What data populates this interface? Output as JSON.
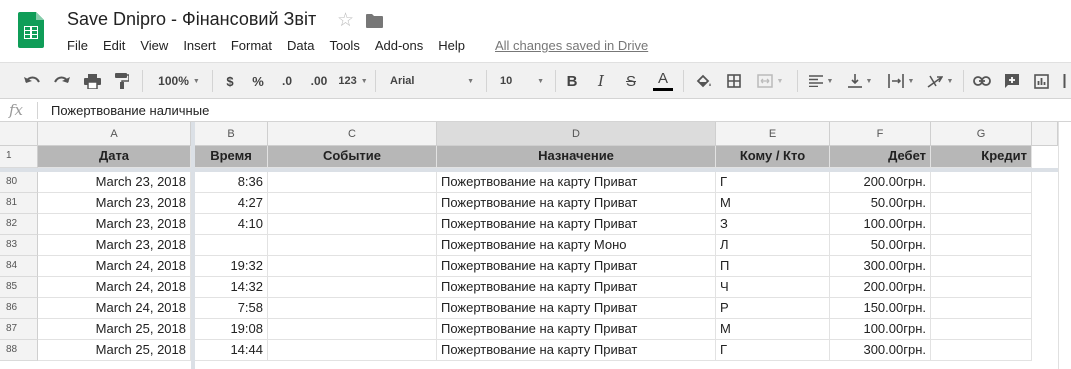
{
  "app": {
    "title": "Save Dnipro - Фінансовий Звіт",
    "star_icon": "☆",
    "saved_status": "All changes saved in Drive",
    "menu": [
      "File",
      "Edit",
      "View",
      "Insert",
      "Format",
      "Data",
      "Tools",
      "Add-ons",
      "Help"
    ],
    "brand_color": "#0f9d58"
  },
  "toolbar": {
    "zoom": "100%",
    "currency": "$",
    "percent": "%",
    "decrease_decimals": ".0",
    "increase_decimals": ".00",
    "more_formats": "123",
    "font": "Arial",
    "font_size": "10",
    "bold": "B",
    "italic": "I",
    "strikethrough": "S",
    "text_color": "A",
    "icons": [
      "undo-icon",
      "redo-icon",
      "print-icon",
      "paint-format-icon",
      "fill-color-icon",
      "borders-icon",
      "merge-cells-icon",
      "horizontal-align-icon",
      "vertical-align-icon",
      "text-wrap-icon",
      "text-rotation-icon",
      "link-icon",
      "comment-icon",
      "chart-icon"
    ]
  },
  "formula_bar": {
    "fx": "fx",
    "content": "Пожертвование наличные"
  },
  "grid": {
    "columns": [
      "A",
      "B",
      "C",
      "D",
      "E",
      "F",
      "G"
    ],
    "header_row_number": "1",
    "headers": [
      "Дата",
      "Время",
      "Событие",
      "Назначение",
      "Кому / Кто",
      "Дебет",
      "Кредит"
    ],
    "rows": [
      {
        "num": "80",
        "date": "March 23, 2018",
        "time": "8:36",
        "event": "",
        "purpose": "Пожертвование на карту Приват",
        "who": "Г",
        "debit": "200.00грн.",
        "credit": ""
      },
      {
        "num": "81",
        "date": "March 23, 2018",
        "time": "4:27",
        "event": "",
        "purpose": "Пожертвование на карту Приват",
        "who": "М",
        "debit": "50.00грн.",
        "credit": ""
      },
      {
        "num": "82",
        "date": "March 23, 2018",
        "time": "4:10",
        "event": "",
        "purpose": "Пожертвование на карту Приват",
        "who": "З",
        "debit": "100.00грн.",
        "credit": ""
      },
      {
        "num": "83",
        "date": "March 23, 2018",
        "time": "",
        "event": "",
        "purpose": "Пожертвование на карту Моно",
        "who": "Л",
        "debit": "50.00грн.",
        "credit": ""
      },
      {
        "num": "84",
        "date": "March 24, 2018",
        "time": "19:32",
        "event": "",
        "purpose": "Пожертвование на карту Приват",
        "who": "П",
        "debit": "300.00грн.",
        "credit": ""
      },
      {
        "num": "85",
        "date": "March 24, 2018",
        "time": "14:32",
        "event": "",
        "purpose": "Пожертвование на карту Приват",
        "who": "Ч",
        "debit": "200.00грн.",
        "credit": ""
      },
      {
        "num": "86",
        "date": "March 24, 2018",
        "time": "7:58",
        "event": "",
        "purpose": "Пожертвование на карту Приват",
        "who": "Р",
        "debit": "150.00грн.",
        "credit": ""
      },
      {
        "num": "87",
        "date": "March 25, 2018",
        "time": "19:08",
        "event": "",
        "purpose": "Пожертвование на карту Приват",
        "who": "М",
        "debit": "100.00грн.",
        "credit": ""
      },
      {
        "num": "88",
        "date": "March 25, 2018",
        "time": "14:44",
        "event": "",
        "purpose": "Пожертвование на карту Приват",
        "who": "Г",
        "debit": "300.00грн.",
        "credit": ""
      }
    ]
  }
}
